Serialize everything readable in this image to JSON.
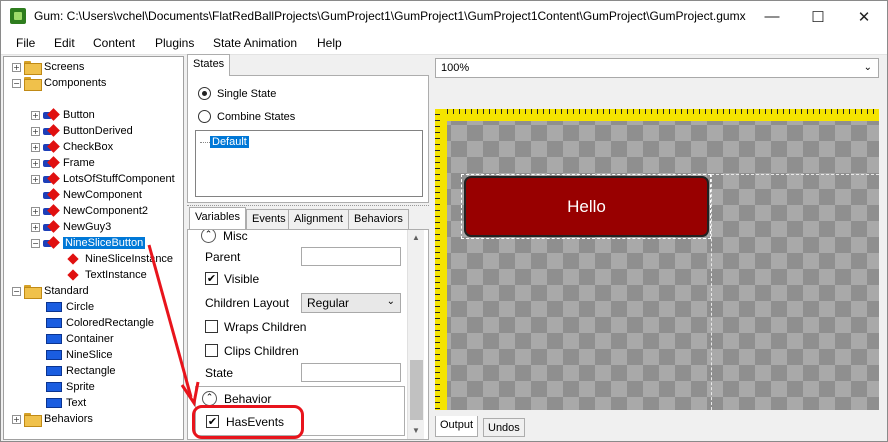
{
  "window": {
    "title": "Gum: C:\\Users\\vchel\\Documents\\FlatRedBallProjects\\GumProject1\\GumProject1\\GumProject1Content\\GumProject\\GumProject.gumx",
    "minimize_label": "—",
    "maximize_label": "☐",
    "close_label": "✕"
  },
  "menu": {
    "items": [
      {
        "label": "File"
      },
      {
        "label": "Edit"
      },
      {
        "label": "Content"
      },
      {
        "label": "Plugins"
      },
      {
        "label": "State Animation"
      },
      {
        "label": "Help"
      }
    ]
  },
  "tree": {
    "top": [
      {
        "label": "Screens",
        "expander": "+"
      },
      {
        "label": "Components",
        "expander": "−"
      }
    ],
    "components": [
      {
        "label": "Button",
        "expander": "+"
      },
      {
        "label": "ButtonDerived",
        "expander": "+"
      },
      {
        "label": "CheckBox",
        "expander": "+"
      },
      {
        "label": "Frame",
        "expander": "+"
      },
      {
        "label": "LotsOfStuffComponent",
        "expander": "+"
      },
      {
        "label": "NewComponent",
        "expander": ""
      },
      {
        "label": "NewComponent2",
        "expander": "+"
      },
      {
        "label": "NewGuy3",
        "expander": "+"
      },
      {
        "label": "NineSliceButton",
        "expander": "−",
        "selected": true
      }
    ],
    "instances": [
      {
        "label": "NineSliceInstance"
      },
      {
        "label": "TextInstance"
      }
    ],
    "standard_folder": {
      "label": "Standard",
      "expander": "−"
    },
    "standard": [
      {
        "label": "Circle"
      },
      {
        "label": "ColoredRectangle"
      },
      {
        "label": "Container"
      },
      {
        "label": "NineSlice"
      },
      {
        "label": "Rectangle"
      },
      {
        "label": "Sprite"
      },
      {
        "label": "Text"
      }
    ],
    "behaviors_folder": {
      "label": "Behaviors",
      "expander": "+"
    }
  },
  "states": {
    "tab_label": "States",
    "single_state_label": "Single State",
    "combine_states_label": "Combine States",
    "selected_mode": "single",
    "items": [
      "Default"
    ]
  },
  "variables": {
    "tabs": [
      {
        "label": "Variables",
        "active": true
      },
      {
        "label": "Events"
      },
      {
        "label": "Alignment"
      },
      {
        "label": "Behaviors"
      }
    ],
    "misc_category": "Misc",
    "parent_label": "Parent",
    "parent_value": "",
    "visible_label": "Visible",
    "visible_checked": true,
    "children_layout_label": "Children Layout",
    "children_layout_value": "Regular",
    "wraps_children_label": "Wraps Children",
    "wraps_children_checked": false,
    "clips_children_label": "Clips Children",
    "clips_children_checked": false,
    "state_label": "State",
    "state_value": "",
    "behavior_category": "Behavior",
    "has_events_label": "HasEvents",
    "has_events_checked": true
  },
  "editor": {
    "zoom_value": "100%",
    "button_text": "Hello",
    "button_color": "#980000"
  },
  "output_tabs": [
    {
      "label": "Output",
      "active": true
    },
    {
      "label": "Undos"
    }
  ],
  "annotation": {
    "color": "#e8141c"
  }
}
